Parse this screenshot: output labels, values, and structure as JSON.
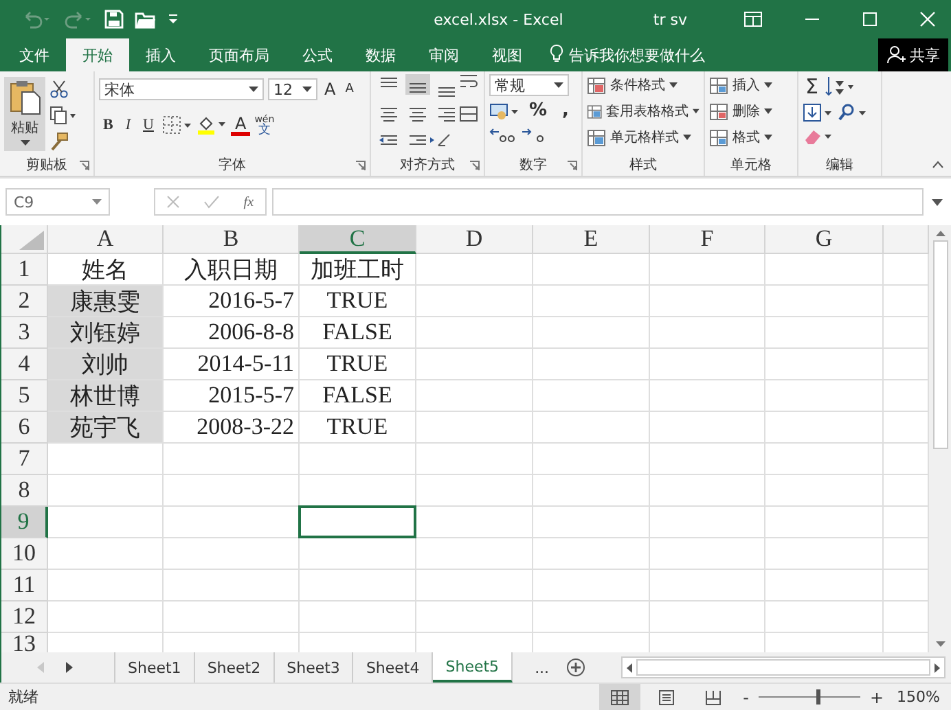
{
  "window": {
    "title": "excel.xlsx  -  Excel",
    "user": "tr sv"
  },
  "ribbon_tabs": [
    {
      "label": "文件",
      "selected": false
    },
    {
      "label": "开始",
      "selected": true
    },
    {
      "label": "插入",
      "selected": false
    },
    {
      "label": "页面布局",
      "selected": false
    },
    {
      "label": "公式",
      "selected": false
    },
    {
      "label": "数据",
      "selected": false
    },
    {
      "label": "审阅",
      "selected": false
    },
    {
      "label": "视图",
      "selected": false
    }
  ],
  "tell_me": "告诉我你想要做什么",
  "share_button": "共享",
  "clipboard": {
    "paste": "粘贴",
    "label": "剪贴板"
  },
  "font": {
    "name": "宋体",
    "size": "12",
    "grow": "A",
    "shrink": "A",
    "format_buttons": [
      {
        "label": "B",
        "kind": "bold"
      },
      {
        "label": "I",
        "kind": "italic"
      },
      {
        "label": "U",
        "kind": "underline"
      }
    ],
    "font_color": "A",
    "phonetic_top": "wén",
    "phonetic_base": "文",
    "label": "字体"
  },
  "alignment": {
    "label": "对齐方式"
  },
  "number": {
    "format": "常规",
    "percent": "%",
    "comma": ",",
    "label": "数字"
  },
  "styles": {
    "buttons": [
      "条件格式",
      "套用表格格式",
      "单元格样式"
    ],
    "label": "样式"
  },
  "cells": {
    "buttons": [
      "插入",
      "删除",
      "格式"
    ],
    "label": "单元格"
  },
  "editing": {
    "sum": "Σ",
    "label": "编辑"
  },
  "formula_bar": {
    "name_box": "C9",
    "fx": "fx"
  },
  "columns": [
    {
      "label": "A",
      "selected": false
    },
    {
      "label": "B",
      "selected": false
    },
    {
      "label": "C",
      "selected": true
    },
    {
      "label": "D",
      "selected": false
    },
    {
      "label": "E",
      "selected": false
    },
    {
      "label": "F",
      "selected": false
    },
    {
      "label": "G",
      "selected": false
    }
  ],
  "rows": [
    {
      "label": "1",
      "selected": false,
      "cells": [
        {
          "text": "姓名",
          "kind": "text",
          "shaded": false
        },
        {
          "text": "入职日期",
          "kind": "text",
          "shaded": false
        },
        {
          "text": "加班工时",
          "kind": "text",
          "shaded": false
        }
      ]
    },
    {
      "label": "2",
      "selected": false,
      "cells": [
        {
          "text": "康惠雯",
          "kind": "text",
          "shaded": true
        },
        {
          "text": "2016-5-7",
          "kind": "date",
          "shaded": false
        },
        {
          "text": "TRUE",
          "kind": "bool",
          "shaded": false
        }
      ]
    },
    {
      "label": "3",
      "selected": false,
      "cells": [
        {
          "text": "刘钰婷",
          "kind": "text",
          "shaded": true
        },
        {
          "text": "2006-8-8",
          "kind": "date",
          "shaded": false
        },
        {
          "text": "FALSE",
          "kind": "bool",
          "shaded": false
        }
      ]
    },
    {
      "label": "4",
      "selected": false,
      "cells": [
        {
          "text": "刘帅",
          "kind": "text",
          "shaded": true
        },
        {
          "text": "2014-5-11",
          "kind": "date",
          "shaded": false
        },
        {
          "text": "TRUE",
          "kind": "bool",
          "shaded": false
        }
      ]
    },
    {
      "label": "5",
      "selected": false,
      "cells": [
        {
          "text": "林世博",
          "kind": "text",
          "shaded": true
        },
        {
          "text": "2015-5-7",
          "kind": "date",
          "shaded": false
        },
        {
          "text": "FALSE",
          "kind": "bool",
          "shaded": false
        }
      ]
    },
    {
      "label": "6",
      "selected": false,
      "cells": [
        {
          "text": "苑宇飞",
          "kind": "text",
          "shaded": true
        },
        {
          "text": "2008-3-22",
          "kind": "date",
          "shaded": false
        },
        {
          "text": "TRUE",
          "kind": "bool",
          "shaded": false
        }
      ]
    },
    {
      "label": "7",
      "selected": false,
      "cells": []
    },
    {
      "label": "8",
      "selected": false,
      "cells": []
    },
    {
      "label": "9",
      "selected": true,
      "cells": []
    },
    {
      "label": "10",
      "selected": false,
      "cells": []
    },
    {
      "label": "11",
      "selected": false,
      "cells": []
    },
    {
      "label": "12",
      "selected": false,
      "cells": []
    },
    {
      "label": "13",
      "selected": false,
      "cells": []
    }
  ],
  "sheet_tabs": [
    {
      "label": "Sheet1",
      "selected": false
    },
    {
      "label": "Sheet2",
      "selected": false
    },
    {
      "label": "Sheet3",
      "selected": false
    },
    {
      "label": "Sheet4",
      "selected": false
    },
    {
      "label": "Sheet5",
      "selected": true
    }
  ],
  "more_sheets": "...",
  "status_bar": {
    "status": "就绪",
    "views": [
      {
        "kind": "normal",
        "selected": true
      },
      {
        "kind": "page_layout",
        "selected": false
      },
      {
        "kind": "page_break",
        "selected": false
      }
    ],
    "zoom_out": "-",
    "zoom_in": "+",
    "zoom": {
      "level": 0.58
    },
    "zoom_text": "150%"
  }
}
